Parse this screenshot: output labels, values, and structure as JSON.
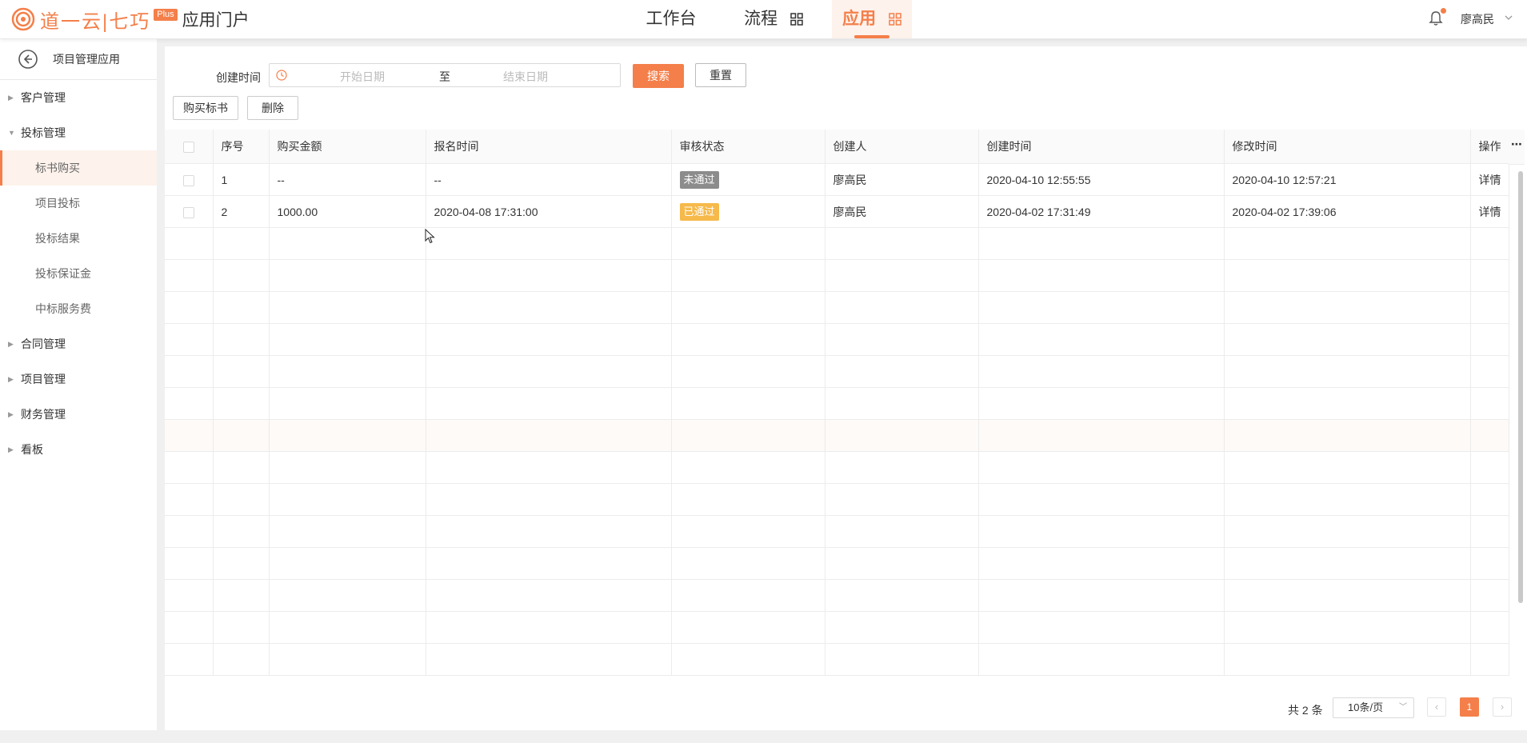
{
  "header": {
    "brand": "道一云|七巧",
    "plus": "Plus",
    "portal": "应用门户",
    "nav": [
      "工作台",
      "流程",
      "应用"
    ],
    "active_nav": "应用",
    "user": "廖高民"
  },
  "sidebar": {
    "title": "项目管理应用",
    "menu": {
      "customer": "客户管理",
      "bidding": "投标管理",
      "sub": [
        "标书购买",
        "项目投标",
        "投标结果",
        "投标保证金",
        "中标服务费"
      ],
      "contract": "合同管理",
      "project": "项目管理",
      "finance": "财务管理",
      "board": "看板"
    }
  },
  "filter": {
    "label": "创建时间",
    "start_placeholder": "开始日期",
    "separator": "至",
    "end_placeholder": "结束日期",
    "search": "搜索",
    "reset": "重置"
  },
  "toolbar": {
    "buy": "购买标书",
    "delete": "删除"
  },
  "table": {
    "headers": [
      "序号",
      "购买金额",
      "报名时间",
      "审核状态",
      "创建人",
      "创建时间",
      "修改时间",
      "操作"
    ],
    "rows": [
      {
        "no": "1",
        "amount": "--",
        "signup": "--",
        "status": "未通过",
        "creator": "廖高民",
        "created": "2020-04-10 12:55:55",
        "modified": "2020-04-10 12:57:21",
        "action": "详情"
      },
      {
        "no": "2",
        "amount": "1000.00",
        "signup": "2020-04-08 17:31:00",
        "status": "已通过",
        "creator": "廖高民",
        "created": "2020-04-02 17:31:49",
        "modified": "2020-04-02 17:39:06",
        "action": "详情"
      }
    ]
  },
  "pagination": {
    "total": "共 2 条",
    "page_size": "10条/页",
    "current": "1"
  },
  "colors": {
    "accent": "#f47f4a",
    "fail_tag": "#8c8c8c",
    "pass_tag": "#f6b94a"
  },
  "icons": [
    "logo-icon",
    "grid-icon",
    "bell-icon",
    "back-icon",
    "clock-icon",
    "more-icon"
  ]
}
